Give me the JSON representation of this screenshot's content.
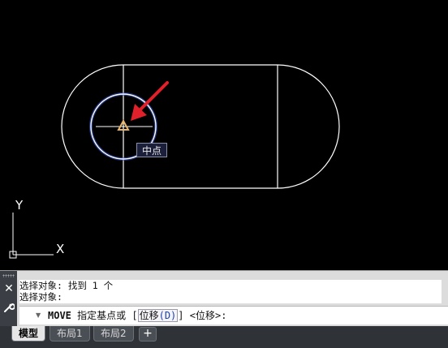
{
  "canvas": {
    "snap_tooltip": "中点",
    "ucs_axis_y": "Y",
    "ucs_axis_x": "X"
  },
  "command_line": {
    "history": [
      "选择对象: 找到 1 个",
      "选择对象:"
    ],
    "command_name": "MOVE",
    "prompt": " 指定基点或 [",
    "option_label": "位移",
    "option_key": "(D)",
    "prompt_tail": "] <位移>:"
  },
  "layout_tabs": {
    "tabs": [
      "模型",
      "布局1",
      "布局2"
    ],
    "active": "模型",
    "add_tab": "+"
  },
  "colors": {
    "drawing_background": "#000000",
    "geometry": "#ffffff",
    "selection_highlight": "#6f8fff",
    "snap_marker": "#e8b46a",
    "annotation_arrow": "#e0202a"
  }
}
